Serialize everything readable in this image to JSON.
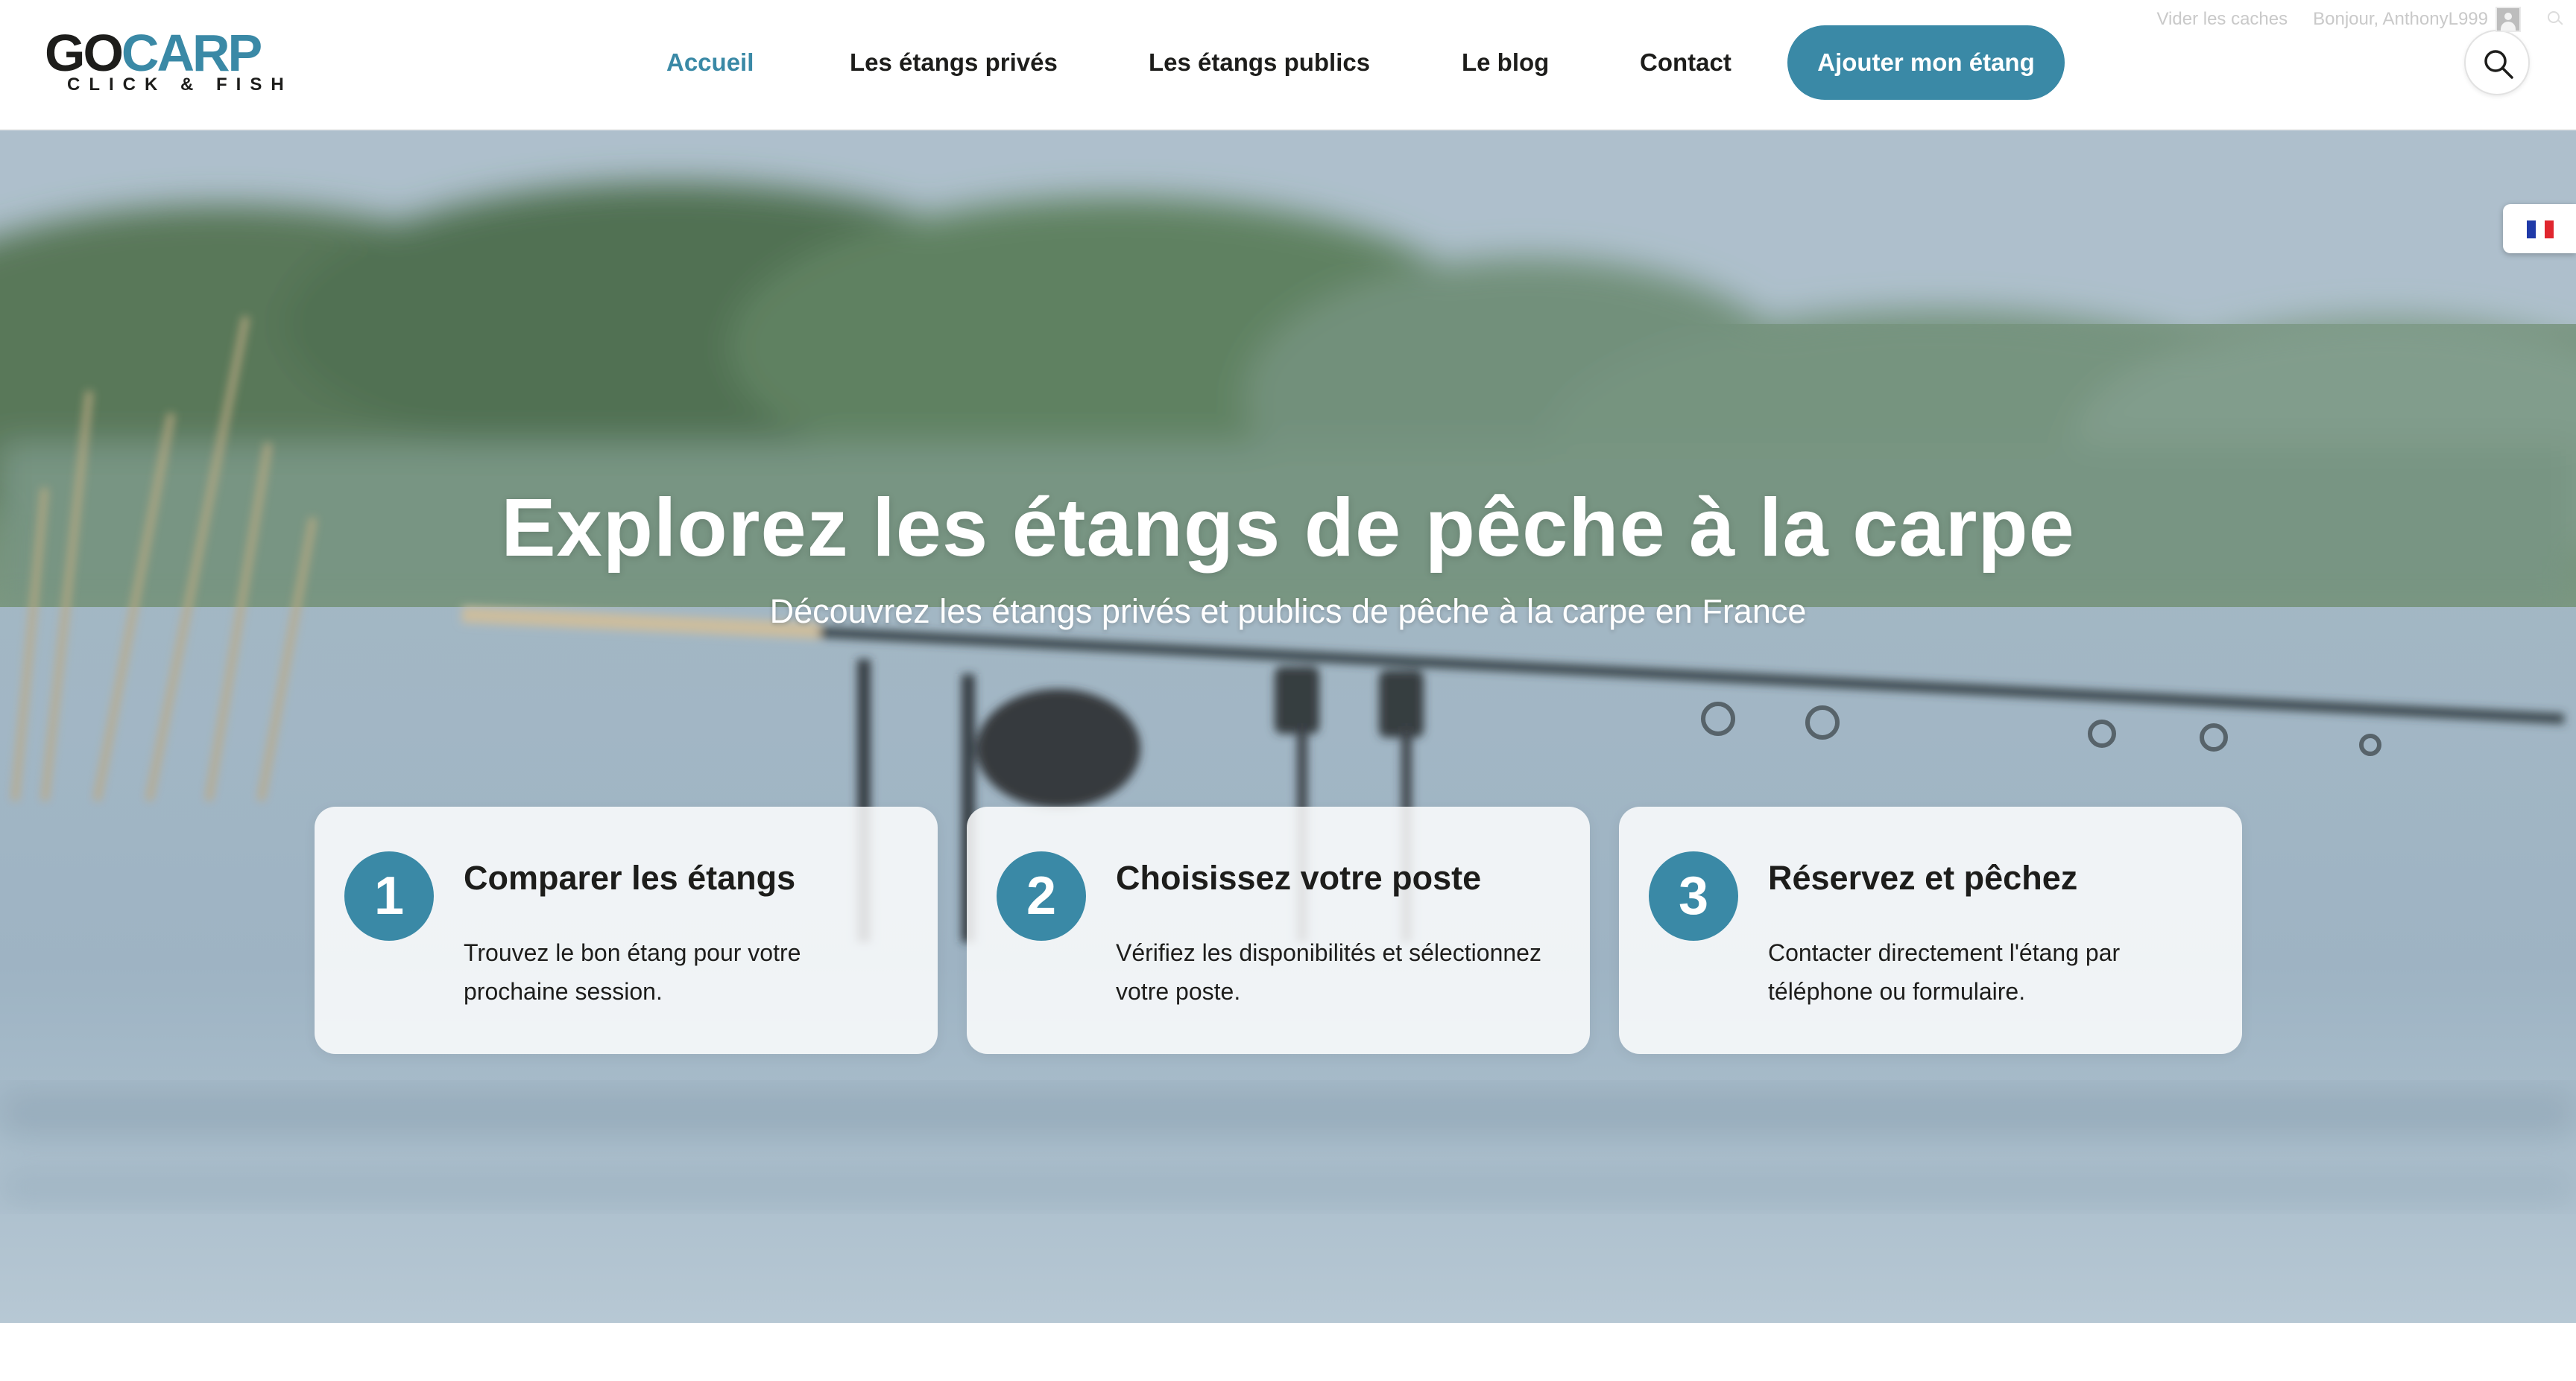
{
  "admin_bar": {
    "clear_cache": "Vider les caches",
    "greeting": "Bonjour, AnthonyL999"
  },
  "logo": {
    "go": "GO",
    "carp": "CARP",
    "tagline": "CLICK & FISH"
  },
  "nav": {
    "items": [
      {
        "label": "Accueil",
        "active": true
      },
      {
        "label": "Les étangs privés",
        "active": false
      },
      {
        "label": "Les étangs publics",
        "active": false
      },
      {
        "label": "Le blog",
        "active": false
      },
      {
        "label": "Contact",
        "active": false
      }
    ],
    "cta_label": "Ajouter mon étang",
    "search_icon": "search-icon"
  },
  "hero": {
    "title": "Explorez les étangs de pêche à la carpe",
    "subtitle": "Découvrez les étangs privés et publics de pêche à la carpe en France"
  },
  "steps": [
    {
      "number": "1",
      "title": "Comparer les étangs",
      "text": "Trouvez le bon étang pour votre prochaine session."
    },
    {
      "number": "2",
      "title": "Choisissez votre poste",
      "text": "Vérifiez les disponibilités et sélectionnez votre poste."
    },
    {
      "number": "3",
      "title": "Réservez et pêchez",
      "text": "Contacter directement l'étang par téléphone ou formulaire."
    }
  ],
  "language": {
    "flag_icon": "french-flag-icon",
    "flag_colors": [
      "#1f3aa8",
      "#ffffff",
      "#e0262e"
    ]
  },
  "colors": {
    "accent": "#3a89a6",
    "text": "#1d1d1b"
  }
}
